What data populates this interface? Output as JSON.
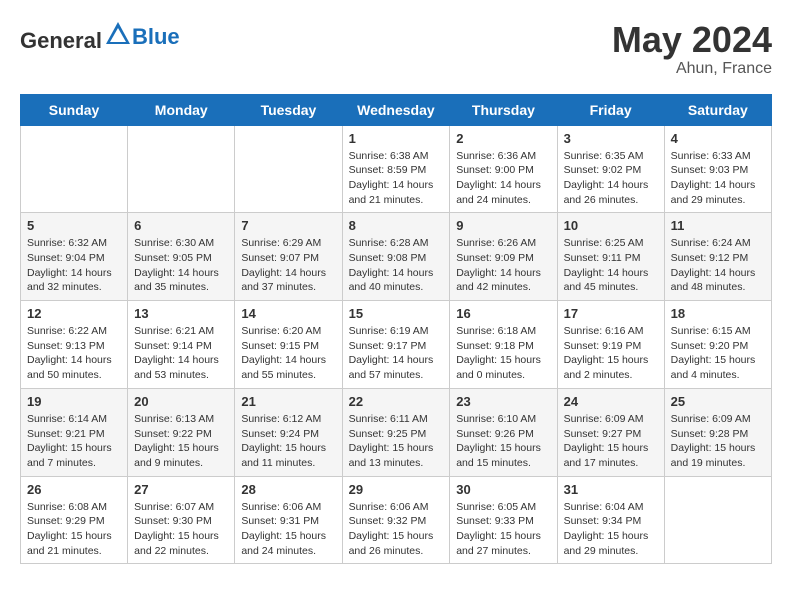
{
  "header": {
    "logo_general": "General",
    "logo_blue": "Blue",
    "month_year": "May 2024",
    "location": "Ahun, France"
  },
  "days_of_week": [
    "Sunday",
    "Monday",
    "Tuesday",
    "Wednesday",
    "Thursday",
    "Friday",
    "Saturday"
  ],
  "weeks": [
    [
      {
        "day": "",
        "info": ""
      },
      {
        "day": "",
        "info": ""
      },
      {
        "day": "",
        "info": ""
      },
      {
        "day": "1",
        "info": "Sunrise: 6:38 AM\nSunset: 8:59 PM\nDaylight: 14 hours\nand 21 minutes."
      },
      {
        "day": "2",
        "info": "Sunrise: 6:36 AM\nSunset: 9:00 PM\nDaylight: 14 hours\nand 24 minutes."
      },
      {
        "day": "3",
        "info": "Sunrise: 6:35 AM\nSunset: 9:02 PM\nDaylight: 14 hours\nand 26 minutes."
      },
      {
        "day": "4",
        "info": "Sunrise: 6:33 AM\nSunset: 9:03 PM\nDaylight: 14 hours\nand 29 minutes."
      }
    ],
    [
      {
        "day": "5",
        "info": "Sunrise: 6:32 AM\nSunset: 9:04 PM\nDaylight: 14 hours\nand 32 minutes."
      },
      {
        "day": "6",
        "info": "Sunrise: 6:30 AM\nSunset: 9:05 PM\nDaylight: 14 hours\nand 35 minutes."
      },
      {
        "day": "7",
        "info": "Sunrise: 6:29 AM\nSunset: 9:07 PM\nDaylight: 14 hours\nand 37 minutes."
      },
      {
        "day": "8",
        "info": "Sunrise: 6:28 AM\nSunset: 9:08 PM\nDaylight: 14 hours\nand 40 minutes."
      },
      {
        "day": "9",
        "info": "Sunrise: 6:26 AM\nSunset: 9:09 PM\nDaylight: 14 hours\nand 42 minutes."
      },
      {
        "day": "10",
        "info": "Sunrise: 6:25 AM\nSunset: 9:11 PM\nDaylight: 14 hours\nand 45 minutes."
      },
      {
        "day": "11",
        "info": "Sunrise: 6:24 AM\nSunset: 9:12 PM\nDaylight: 14 hours\nand 48 minutes."
      }
    ],
    [
      {
        "day": "12",
        "info": "Sunrise: 6:22 AM\nSunset: 9:13 PM\nDaylight: 14 hours\nand 50 minutes."
      },
      {
        "day": "13",
        "info": "Sunrise: 6:21 AM\nSunset: 9:14 PM\nDaylight: 14 hours\nand 53 minutes."
      },
      {
        "day": "14",
        "info": "Sunrise: 6:20 AM\nSunset: 9:15 PM\nDaylight: 14 hours\nand 55 minutes."
      },
      {
        "day": "15",
        "info": "Sunrise: 6:19 AM\nSunset: 9:17 PM\nDaylight: 14 hours\nand 57 minutes."
      },
      {
        "day": "16",
        "info": "Sunrise: 6:18 AM\nSunset: 9:18 PM\nDaylight: 15 hours\nand 0 minutes."
      },
      {
        "day": "17",
        "info": "Sunrise: 6:16 AM\nSunset: 9:19 PM\nDaylight: 15 hours\nand 2 minutes."
      },
      {
        "day": "18",
        "info": "Sunrise: 6:15 AM\nSunset: 9:20 PM\nDaylight: 15 hours\nand 4 minutes."
      }
    ],
    [
      {
        "day": "19",
        "info": "Sunrise: 6:14 AM\nSunset: 9:21 PM\nDaylight: 15 hours\nand 7 minutes."
      },
      {
        "day": "20",
        "info": "Sunrise: 6:13 AM\nSunset: 9:22 PM\nDaylight: 15 hours\nand 9 minutes."
      },
      {
        "day": "21",
        "info": "Sunrise: 6:12 AM\nSunset: 9:24 PM\nDaylight: 15 hours\nand 11 minutes."
      },
      {
        "day": "22",
        "info": "Sunrise: 6:11 AM\nSunset: 9:25 PM\nDaylight: 15 hours\nand 13 minutes."
      },
      {
        "day": "23",
        "info": "Sunrise: 6:10 AM\nSunset: 9:26 PM\nDaylight: 15 hours\nand 15 minutes."
      },
      {
        "day": "24",
        "info": "Sunrise: 6:09 AM\nSunset: 9:27 PM\nDaylight: 15 hours\nand 17 minutes."
      },
      {
        "day": "25",
        "info": "Sunrise: 6:09 AM\nSunset: 9:28 PM\nDaylight: 15 hours\nand 19 minutes."
      }
    ],
    [
      {
        "day": "26",
        "info": "Sunrise: 6:08 AM\nSunset: 9:29 PM\nDaylight: 15 hours\nand 21 minutes."
      },
      {
        "day": "27",
        "info": "Sunrise: 6:07 AM\nSunset: 9:30 PM\nDaylight: 15 hours\nand 22 minutes."
      },
      {
        "day": "28",
        "info": "Sunrise: 6:06 AM\nSunset: 9:31 PM\nDaylight: 15 hours\nand 24 minutes."
      },
      {
        "day": "29",
        "info": "Sunrise: 6:06 AM\nSunset: 9:32 PM\nDaylight: 15 hours\nand 26 minutes."
      },
      {
        "day": "30",
        "info": "Sunrise: 6:05 AM\nSunset: 9:33 PM\nDaylight: 15 hours\nand 27 minutes."
      },
      {
        "day": "31",
        "info": "Sunrise: 6:04 AM\nSunset: 9:34 PM\nDaylight: 15 hours\nand 29 minutes."
      },
      {
        "day": "",
        "info": ""
      }
    ]
  ]
}
